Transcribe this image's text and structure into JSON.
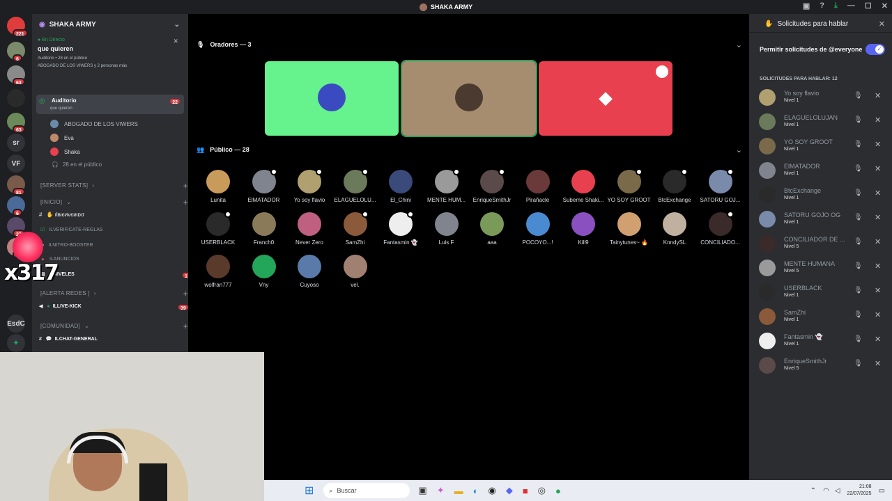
{
  "window": {
    "title": "SHAKA ARMY"
  },
  "servers": [
    {
      "label": "",
      "badge": "221",
      "color": "#e03c3c"
    },
    {
      "label": "",
      "badge": "6",
      "color": "#7a8a6a"
    },
    {
      "label": "",
      "badge": "63",
      "color": "#8a8a8a"
    },
    {
      "label": "",
      "badge": "",
      "color": "#2a2a2a"
    },
    {
      "label": "",
      "badge": "63",
      "color": "#6a8a5a"
    },
    {
      "label": "sr",
      "badge": "",
      "color": "#313338"
    },
    {
      "label": "VF",
      "badge": "",
      "color": "#313338"
    },
    {
      "label": "",
      "badge": "81",
      "color": "#7a5a4a"
    },
    {
      "label": "",
      "badge": "6",
      "color": "#4a6a9a"
    },
    {
      "label": "",
      "badge": "22",
      "color": "#5a4a6a"
    },
    {
      "label": "",
      "badge": "5",
      "color": "#c08080"
    },
    {
      "label": "EsdC",
      "badge": "",
      "color": "#313338"
    }
  ],
  "overlay": {
    "counter": "x317"
  },
  "channel_panel": {
    "server_name": "SHAKA ARMY",
    "live": {
      "tag": "En Directo",
      "topic": "que quieren",
      "line1": "Auditorio • 28 en el público",
      "line2": "ABOGADO DE LOS VIWERS y 2 personas más"
    },
    "stage_channel": {
      "name": "Auditorio",
      "topic": "que quieren",
      "badge": "22"
    },
    "speakers": [
      "ABOGADO DE LOS VIWERS",
      "Eva",
      "Shaka"
    ],
    "audience": "28 en el público",
    "categories": {
      "server_stats": "[SERVER STATS]",
      "inicio": "[INICIO]",
      "alerta": "[ALERTA REDES ]",
      "comunidad": "[COMUNIDAD]"
    },
    "channels": {
      "bienvenido": "вιєиνєиιᴅσ",
      "verificate": "verificate-reglas",
      "nitro": "nitro-booster",
      "anuncios": "anuncios",
      "niveles": "niveles",
      "niveles_badge": "1",
      "live_kick": "live-kick",
      "live_kick_badge": "39",
      "chat": "chat-general"
    }
  },
  "stage": {
    "speakers_header": "Oradores — 3",
    "audience_header": "Público — 28",
    "speaker_tiles": [
      {
        "color": "#66f28d"
      },
      {
        "color": "#a68d70"
      },
      {
        "color": "#e8404e"
      }
    ],
    "audience": [
      {
        "name": "Lunita",
        "color": "#c99b5a",
        "mic": false
      },
      {
        "name": "ElMATADOR",
        "color": "#80848e",
        "mic": true
      },
      {
        "name": "Yo soy flavio",
        "color": "#b0a070",
        "mic": true
      },
      {
        "name": "ELAGUELOLU...",
        "color": "#6a7a5a",
        "mic": true
      },
      {
        "name": "El_Chini",
        "color": "#3a4a7a",
        "mic": false
      },
      {
        "name": "MENTE HUM...",
        "color": "#9a9a9a",
        "mic": true
      },
      {
        "name": "EnriqueSmithJr",
        "color": "#5a4a4a",
        "mic": true
      },
      {
        "name": "Pirañacle",
        "color": "#6a3a3a",
        "mic": false
      },
      {
        "name": "Subeme Shaki...",
        "color": "#e8404e",
        "mic": false
      },
      {
        "name": "YO SOY GROOT",
        "color": "#7a6a4a",
        "mic": true
      },
      {
        "name": "BtcExchange",
        "color": "#2a2a2a",
        "mic": true
      },
      {
        "name": "SATORU GOJ...",
        "color": "#7a8aaa",
        "mic": true
      },
      {
        "name": "USERBLACK",
        "color": "#2a2a2a",
        "mic": true
      },
      {
        "name": "Franch0",
        "color": "#8a7a5a",
        "mic": false
      },
      {
        "name": "Never Zero",
        "color": "#c06080",
        "mic": false
      },
      {
        "name": "SamZhi",
        "color": "#8a5a3a",
        "mic": true
      },
      {
        "name": "Fantasmin 👻",
        "color": "#eeeeee",
        "mic": true
      },
      {
        "name": "Luis F",
        "color": "#80848e",
        "mic": false
      },
      {
        "name": "aaa",
        "color": "#7a9a5a",
        "mic": false
      },
      {
        "name": "POCOYO...!",
        "color": "#4a8ad0",
        "mic": false
      },
      {
        "name": "Kill9",
        "color": "#8a50c0",
        "mic": false
      },
      {
        "name": "Tainytunes~ 🔥",
        "color": "#d0a070",
        "mic": false
      },
      {
        "name": "KnndySL",
        "color": "#c0b0a0",
        "mic": false
      },
      {
        "name": "CONCILIADO...",
        "color": "#3a2a2a",
        "mic": true
      },
      {
        "name": "wolfran777",
        "color": "#5a3a2a",
        "mic": false
      },
      {
        "name": "Vny",
        "color": "#23a55a",
        "mic": false
      },
      {
        "name": "Cuyoso",
        "color": "#5a7aaa",
        "mic": false
      },
      {
        "name": "vel.",
        "color": "#a08070",
        "mic": false
      }
    ]
  },
  "requests_panel": {
    "title": "Solicitudes para hablar",
    "toggle_label": "Permitir solicitudes de @everyone",
    "toggle_on": true,
    "list_header": "SOLICITUDES PARA HABLAR: 12",
    "items": [
      {
        "name": "Yo soy flavio",
        "level": "Nivel 1",
        "color": "#b0a070"
      },
      {
        "name": "ELAGUELOLUJAN",
        "level": "Nivel 1",
        "color": "#6a7a5a"
      },
      {
        "name": "YO SOY GROOT",
        "level": "Nivel 1",
        "color": "#7a6a4a"
      },
      {
        "name": "ElMATADOR",
        "level": "Nivel 1",
        "color": "#80848e"
      },
      {
        "name": "BtcExchange",
        "level": "Nivel 1",
        "color": "#2a2a2a"
      },
      {
        "name": "SATORU GOJO OG",
        "level": "Nivel 1",
        "color": "#7a8aaa"
      },
      {
        "name": "CONCILIADOR DE ...",
        "level": "Nivel 5",
        "color": "#3a2a2a"
      },
      {
        "name": "MENTE HUMANA",
        "level": "Nivel 5",
        "color": "#9a9a9a"
      },
      {
        "name": "USERBLACK",
        "level": "Nivel 1",
        "color": "#2a2a2a"
      },
      {
        "name": "SamZhi",
        "level": "Nivel 1",
        "color": "#8a5a3a"
      },
      {
        "name": "Fantasmin 👻",
        "level": "Nivel 1",
        "color": "#eeeeee"
      },
      {
        "name": "EnriqueSmithJr",
        "level": "Nivel 5",
        "color": "#5a4a4a"
      }
    ]
  },
  "taskbar": {
    "search_placeholder": "Buscar",
    "time": "21:08",
    "date": "22/07/2025"
  }
}
